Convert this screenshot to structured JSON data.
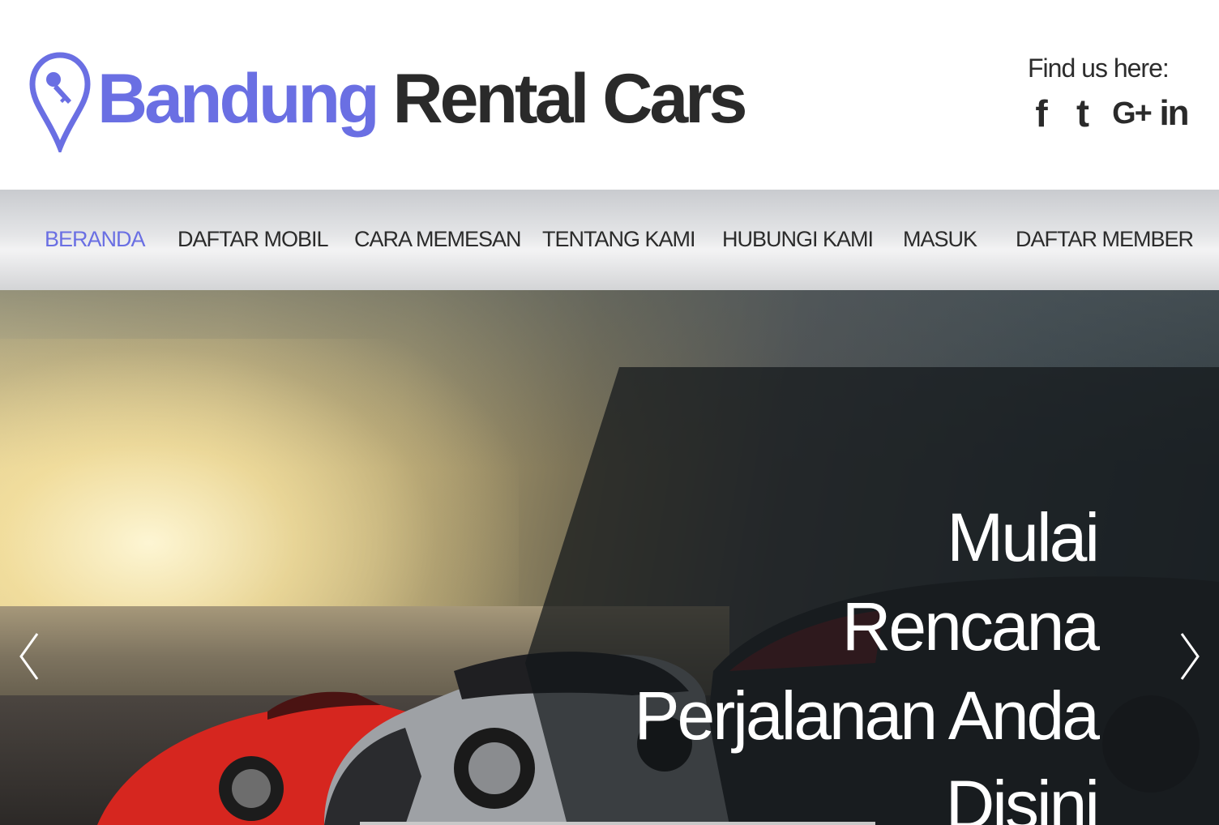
{
  "brand": {
    "word1": "Bandung",
    "word2": "Rental Cars",
    "accent_color": "#6a6fe3",
    "dark_color": "#2a2a2a",
    "logo_icon": "map-pin-key-icon"
  },
  "social": {
    "label": "Find us here:",
    "icons": [
      {
        "name": "facebook-icon",
        "glyph": "f"
      },
      {
        "name": "twitter-icon",
        "glyph": "t"
      },
      {
        "name": "google-plus-icon",
        "glyph": "G+"
      },
      {
        "name": "linkedin-icon",
        "glyph": "in"
      }
    ]
  },
  "nav": {
    "items": [
      {
        "label": "BERANDA",
        "active": true
      },
      {
        "label": "DAFTAR MOBIL",
        "active": false
      },
      {
        "label": "CARA MEMESAN",
        "active": false
      },
      {
        "label": "TENTANG KAMI",
        "active": false
      },
      {
        "label": "HUBUNGI KAMI",
        "active": false
      },
      {
        "label": "MASUK",
        "active": false
      },
      {
        "label": "DAFTAR MEMBER",
        "active": false
      }
    ]
  },
  "hero": {
    "caption_lines": [
      "Mulai",
      "Rencana",
      "Perjalanan Anda",
      "Disini"
    ],
    "prev_icon": "chevron-left-icon",
    "next_icon": "chevron-right-icon"
  }
}
